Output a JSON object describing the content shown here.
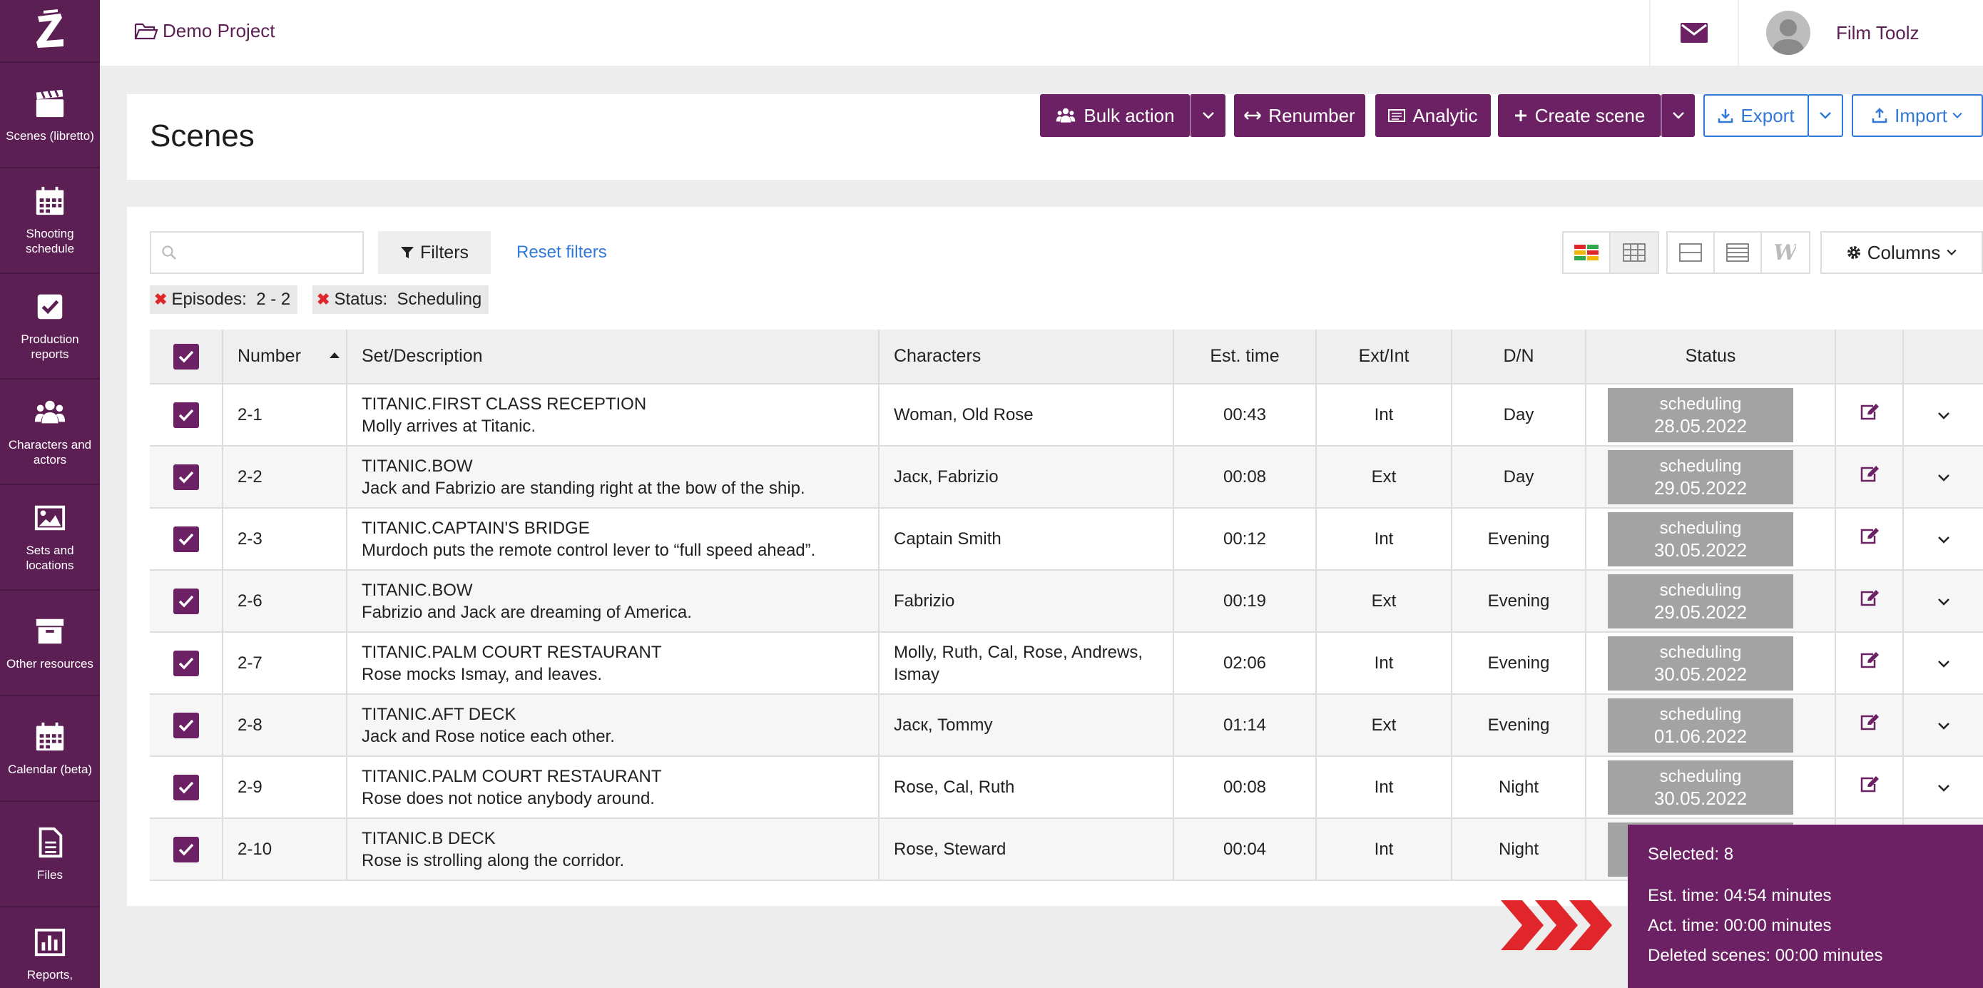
{
  "sidebar": {
    "items": [
      {
        "label": "Scenes (libretto)",
        "icon": "clapperboard-icon"
      },
      {
        "label": "Shooting schedule",
        "icon": "calendar-icon"
      },
      {
        "label": "Production reports",
        "icon": "checkbox-icon"
      },
      {
        "label": "Characters and actors",
        "icon": "users-icon"
      },
      {
        "label": "Sets and locations",
        "icon": "image-icon"
      },
      {
        "label": "Other resources",
        "icon": "archive-icon"
      },
      {
        "label": "Calendar (beta)",
        "icon": "calendar-icon"
      },
      {
        "label": "Files",
        "icon": "file-icon"
      },
      {
        "label": "Reports,",
        "icon": "bar-chart-icon"
      }
    ]
  },
  "topbar": {
    "project_name": "Demo Project",
    "user_name": "Film Toolz"
  },
  "header": {
    "title": "Scenes",
    "bulk_action": "Bulk action",
    "renumber": "Renumber",
    "analytic": "Analytic",
    "create_scene": "Create scene",
    "export": "Export",
    "import": "Import"
  },
  "toolbar": {
    "search_placeholder": "",
    "filters": "Filters",
    "reset_filters": "Reset filters",
    "columns": "Columns"
  },
  "chips": [
    {
      "label": "Episodes:",
      "value": "2 - 2"
    },
    {
      "label": "Status:",
      "value": "Scheduling"
    }
  ],
  "table": {
    "headers": {
      "number": "Number",
      "set": "Set/Description",
      "characters": "Characters",
      "est_time": "Est. time",
      "ext_int": "Ext/Int",
      "dn": "D/N",
      "status": "Status"
    },
    "rows": [
      {
        "number": "2-1",
        "set": "TITANIC.FIRST CLASS RECEPTION",
        "desc": "Molly arrives at Titanic.",
        "characters": "Woman, Old Rose",
        "est": "00:43",
        "extint": "Int",
        "dn": "Day",
        "status": "scheduling",
        "date": "28.05.2022"
      },
      {
        "number": "2-2",
        "set": "TITANIC.BOW",
        "desc": "Jack and Fabrizio are standing right at the bow of the ship.",
        "characters": "Jacк, Fabrizio",
        "est": "00:08",
        "extint": "Ext",
        "dn": "Day",
        "status": "scheduling",
        "date": "29.05.2022"
      },
      {
        "number": "2-3",
        "set": "TITANIC.CAPTAIN'S BRIDGE",
        "desc": "Murdoch puts the remote control lever to “full speed ahead”.",
        "characters": "Captain Smith",
        "est": "00:12",
        "extint": "Int",
        "dn": "Evening",
        "status": "scheduling",
        "date": "30.05.2022"
      },
      {
        "number": "2-6",
        "set": "TITANIC.BOW",
        "desc": "Fabrizio and Jack are dreaming of America.",
        "characters": "Fabrizio",
        "est": "00:19",
        "extint": "Ext",
        "dn": "Evening",
        "status": "scheduling",
        "date": "29.05.2022"
      },
      {
        "number": "2-7",
        "set": "TITANIC.PALM COURT RESTAURANT",
        "desc": "Rose mocks Ismay, and leaves.",
        "characters": "Molly, Ruth, Cal, Rose, Andrews, Ismay",
        "est": "02:06",
        "extint": "Int",
        "dn": "Evening",
        "status": "scheduling",
        "date": "30.05.2022"
      },
      {
        "number": "2-8",
        "set": "TITANIC.AFT DECK",
        "desc": "Jack and Rose notice each other.",
        "characters": "Jacк, Tommy",
        "est": "01:14",
        "extint": "Ext",
        "dn": "Evening",
        "status": "scheduling",
        "date": "01.06.2022"
      },
      {
        "number": "2-9",
        "set": "TITANIC.PALM COURT RESTAURANT",
        "desc": "Rose does not notice anybody around.",
        "characters": "Rose, Cal, Ruth",
        "est": "00:08",
        "extint": "Int",
        "dn": "Night",
        "status": "scheduling",
        "date": "30.05.2022"
      },
      {
        "number": "2-10",
        "set": "TITANIC.B DECK",
        "desc": "Rose is strolling along the corridor.",
        "characters": "Rose, Steward",
        "est": "00:04",
        "extint": "Int",
        "dn": "Night",
        "status": "",
        "date": ""
      }
    ]
  },
  "summary": {
    "selected": "Selected: 8",
    "est_time": "Est. time: 04:54 minutes",
    "act_time": "Act. time: 00:00 minutes",
    "deleted": "Deleted scenes: 00:00 minutes"
  },
  "colors": {
    "primary": "#6b2163",
    "sidebar": "#5c1f54",
    "link": "#3079d8",
    "status_badge": "#a3a3a3",
    "arrow": "#e0262b"
  }
}
